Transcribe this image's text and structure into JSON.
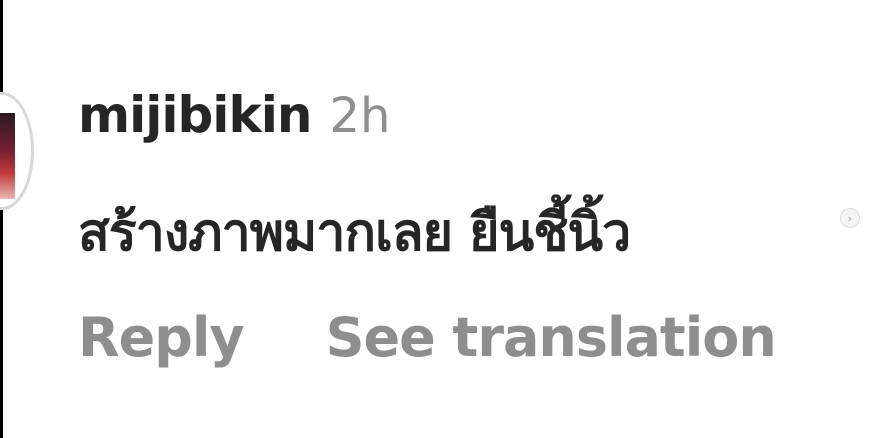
{
  "comment": {
    "username": "mijibikin",
    "timestamp": "2h",
    "text": "สร้างภาพมากเลย ยืนชี้นิ้ว",
    "actions": {
      "reply_label": "Reply",
      "translate_label": "See translation"
    }
  },
  "nav_icon": "chevron-right-icon",
  "colors": {
    "primary_text": "#262626",
    "secondary_text": "#8e8e8e",
    "background": "#ffffff"
  }
}
